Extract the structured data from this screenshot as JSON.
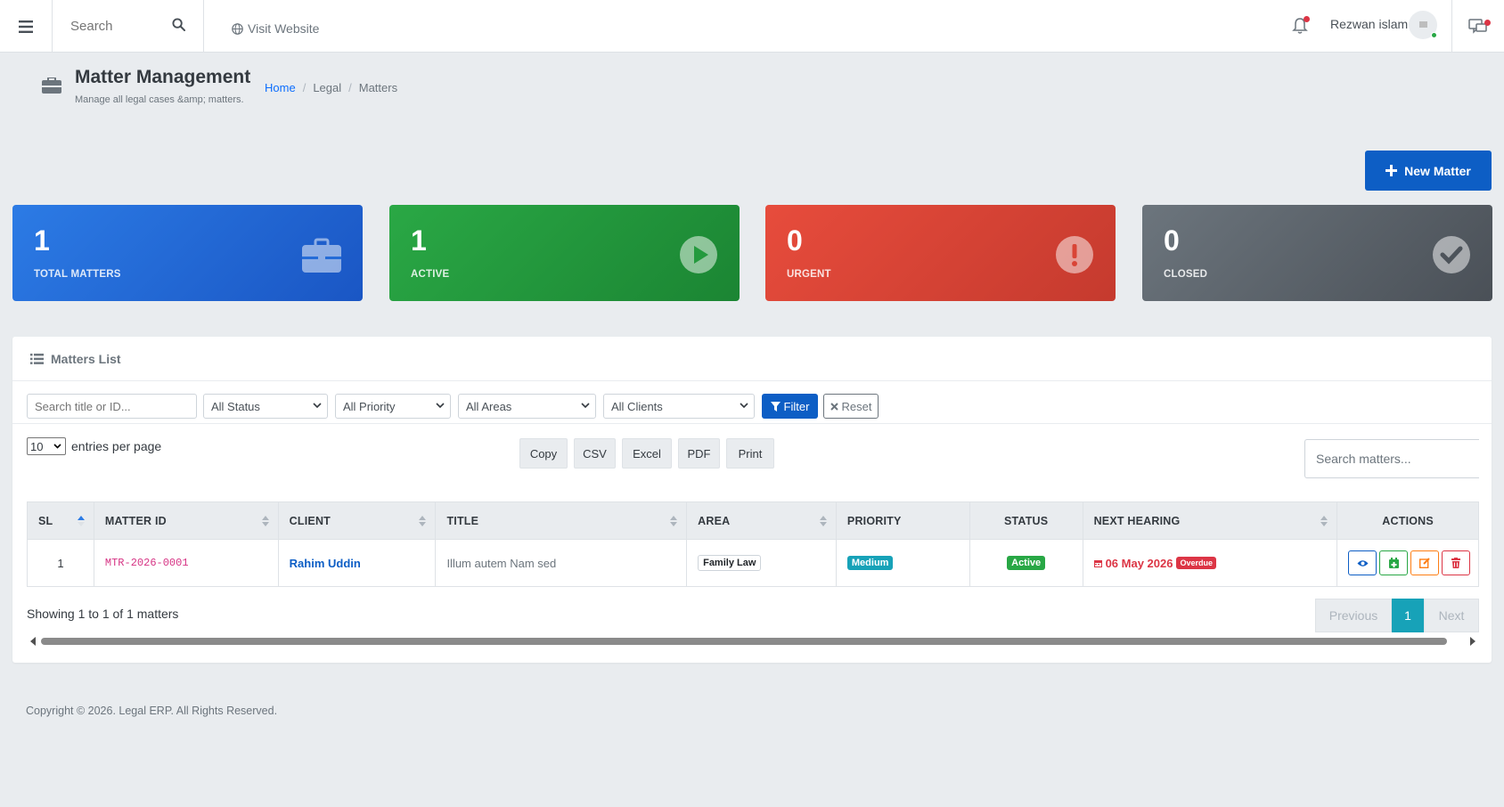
{
  "topnav": {
    "search_placeholder": "Search",
    "visit_label": "Visit Website",
    "user_name": "Rezwan islam"
  },
  "page": {
    "title": "Matter Management",
    "subtitle": "Manage all legal cases &amp; matters.",
    "breadcrumb": [
      "Home",
      "Legal",
      "Matters"
    ]
  },
  "new_matter_label": "New Matter",
  "stats": [
    {
      "value": "1",
      "label": "TOTAL MATTERS",
      "icon": "briefcase-icon",
      "color": "#2c7be5"
    },
    {
      "value": "1",
      "label": "ACTIVE",
      "icon": "play-icon",
      "color": "#2aa845"
    },
    {
      "value": "0",
      "label": "URGENT",
      "icon": "exclamation-icon",
      "color": "#e74c3c"
    },
    {
      "value": "0",
      "label": "CLOSED",
      "icon": "check-icon",
      "color": "#6c757d"
    }
  ],
  "panel": {
    "title": "Matters List",
    "filters": {
      "search_placeholder": "Search title or ID...",
      "status": "All Status",
      "priority": "All Priority",
      "area": "All Areas",
      "client": "All Clients",
      "filter_label": "Filter",
      "reset_label": "Reset"
    },
    "entries_value": "10",
    "entries_label": "entries per page",
    "export_buttons": [
      "Copy",
      "CSV",
      "Excel",
      "PDF",
      "Print"
    ],
    "table_search_placeholder": "Search matters...",
    "columns": [
      "SL",
      "MATTER ID",
      "CLIENT",
      "TITLE",
      "AREA",
      "PRIORITY",
      "STATUS",
      "NEXT HEARING",
      "ACTIONS"
    ],
    "rows": [
      {
        "sl": "1",
        "matter_id": "MTR-2026-0001",
        "client": "Rahim Uddin",
        "title": "Illum autem Nam sed",
        "area": "Family Law",
        "priority": "Medium",
        "status": "Active",
        "next_hearing": "06 May 2026",
        "hearing_badge": "Overdue"
      }
    ],
    "showing": "Showing 1 to 1 of 1 matters",
    "pager": {
      "previous": "Previous",
      "page": "1",
      "next": "Next"
    }
  },
  "footer": "Copyright © 2026. Legal ERP. All Rights Reserved."
}
